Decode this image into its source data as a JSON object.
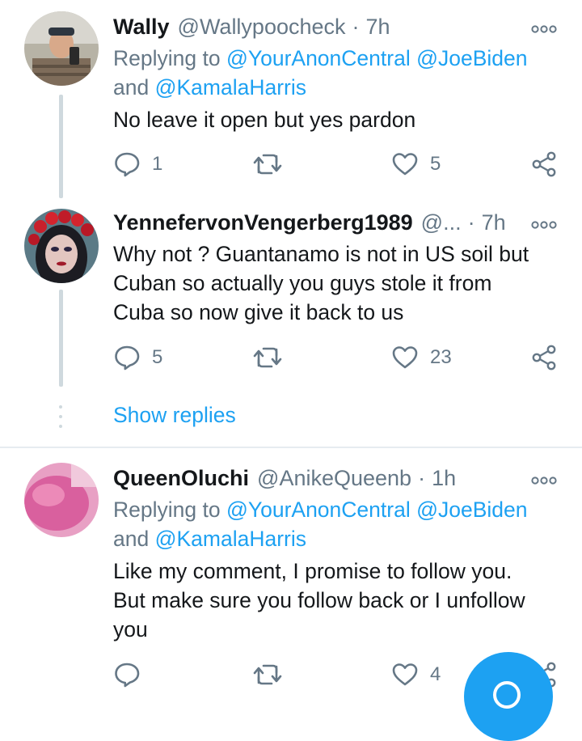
{
  "tweets": [
    {
      "name": "Wally",
      "handle": "@Wallypoocheck",
      "dot": "·",
      "time": "7h",
      "replying_prefix": "Replying to ",
      "mention1": "@YourAnonCentral",
      "mention2": "@JoeBiden",
      "and_text": "and ",
      "mention3": "@KamalaHarris",
      "text": "No leave it open but yes pardon",
      "reply_count": "1",
      "retweet_count": "",
      "like_count": "5"
    },
    {
      "name": "YennefervonVengerberg1989",
      "handle": "@...",
      "dot": "·",
      "time": "7h",
      "text_line1": "Why not ? Guantanamo is not in US soil but",
      "text_line2": "Cuban so actually you guys stole it from",
      "text_line3": "Cuba so now give it back to us",
      "reply_count": "5",
      "retweet_count": "",
      "like_count": "23"
    },
    {
      "name": "QueenOluchi",
      "handle": "@AnikeQueenb",
      "dot": "·",
      "time": "1h",
      "replying_prefix": "Replying to ",
      "mention1": "@YourAnonCentral",
      "mention2": "@JoeBiden",
      "and_text": "and ",
      "mention3": "@KamalaHarris",
      "text_line1": "Like my comment, I promise to follow you.",
      "text_line2": "But make sure you follow back or I unfollow",
      "text_line3": "you",
      "reply_count": "",
      "retweet_count": "",
      "like_count": "4"
    }
  ],
  "show_replies": "Show replies",
  "icons": {
    "reply": "reply-icon",
    "retweet": "retweet-icon",
    "like": "heart-icon",
    "share": "share-icon",
    "more": "more-options-icon",
    "compose": "compose-icon"
  },
  "colors": {
    "accent": "#1da1f2",
    "muted": "#657786",
    "text": "#14171a",
    "line": "#cfd9de"
  }
}
